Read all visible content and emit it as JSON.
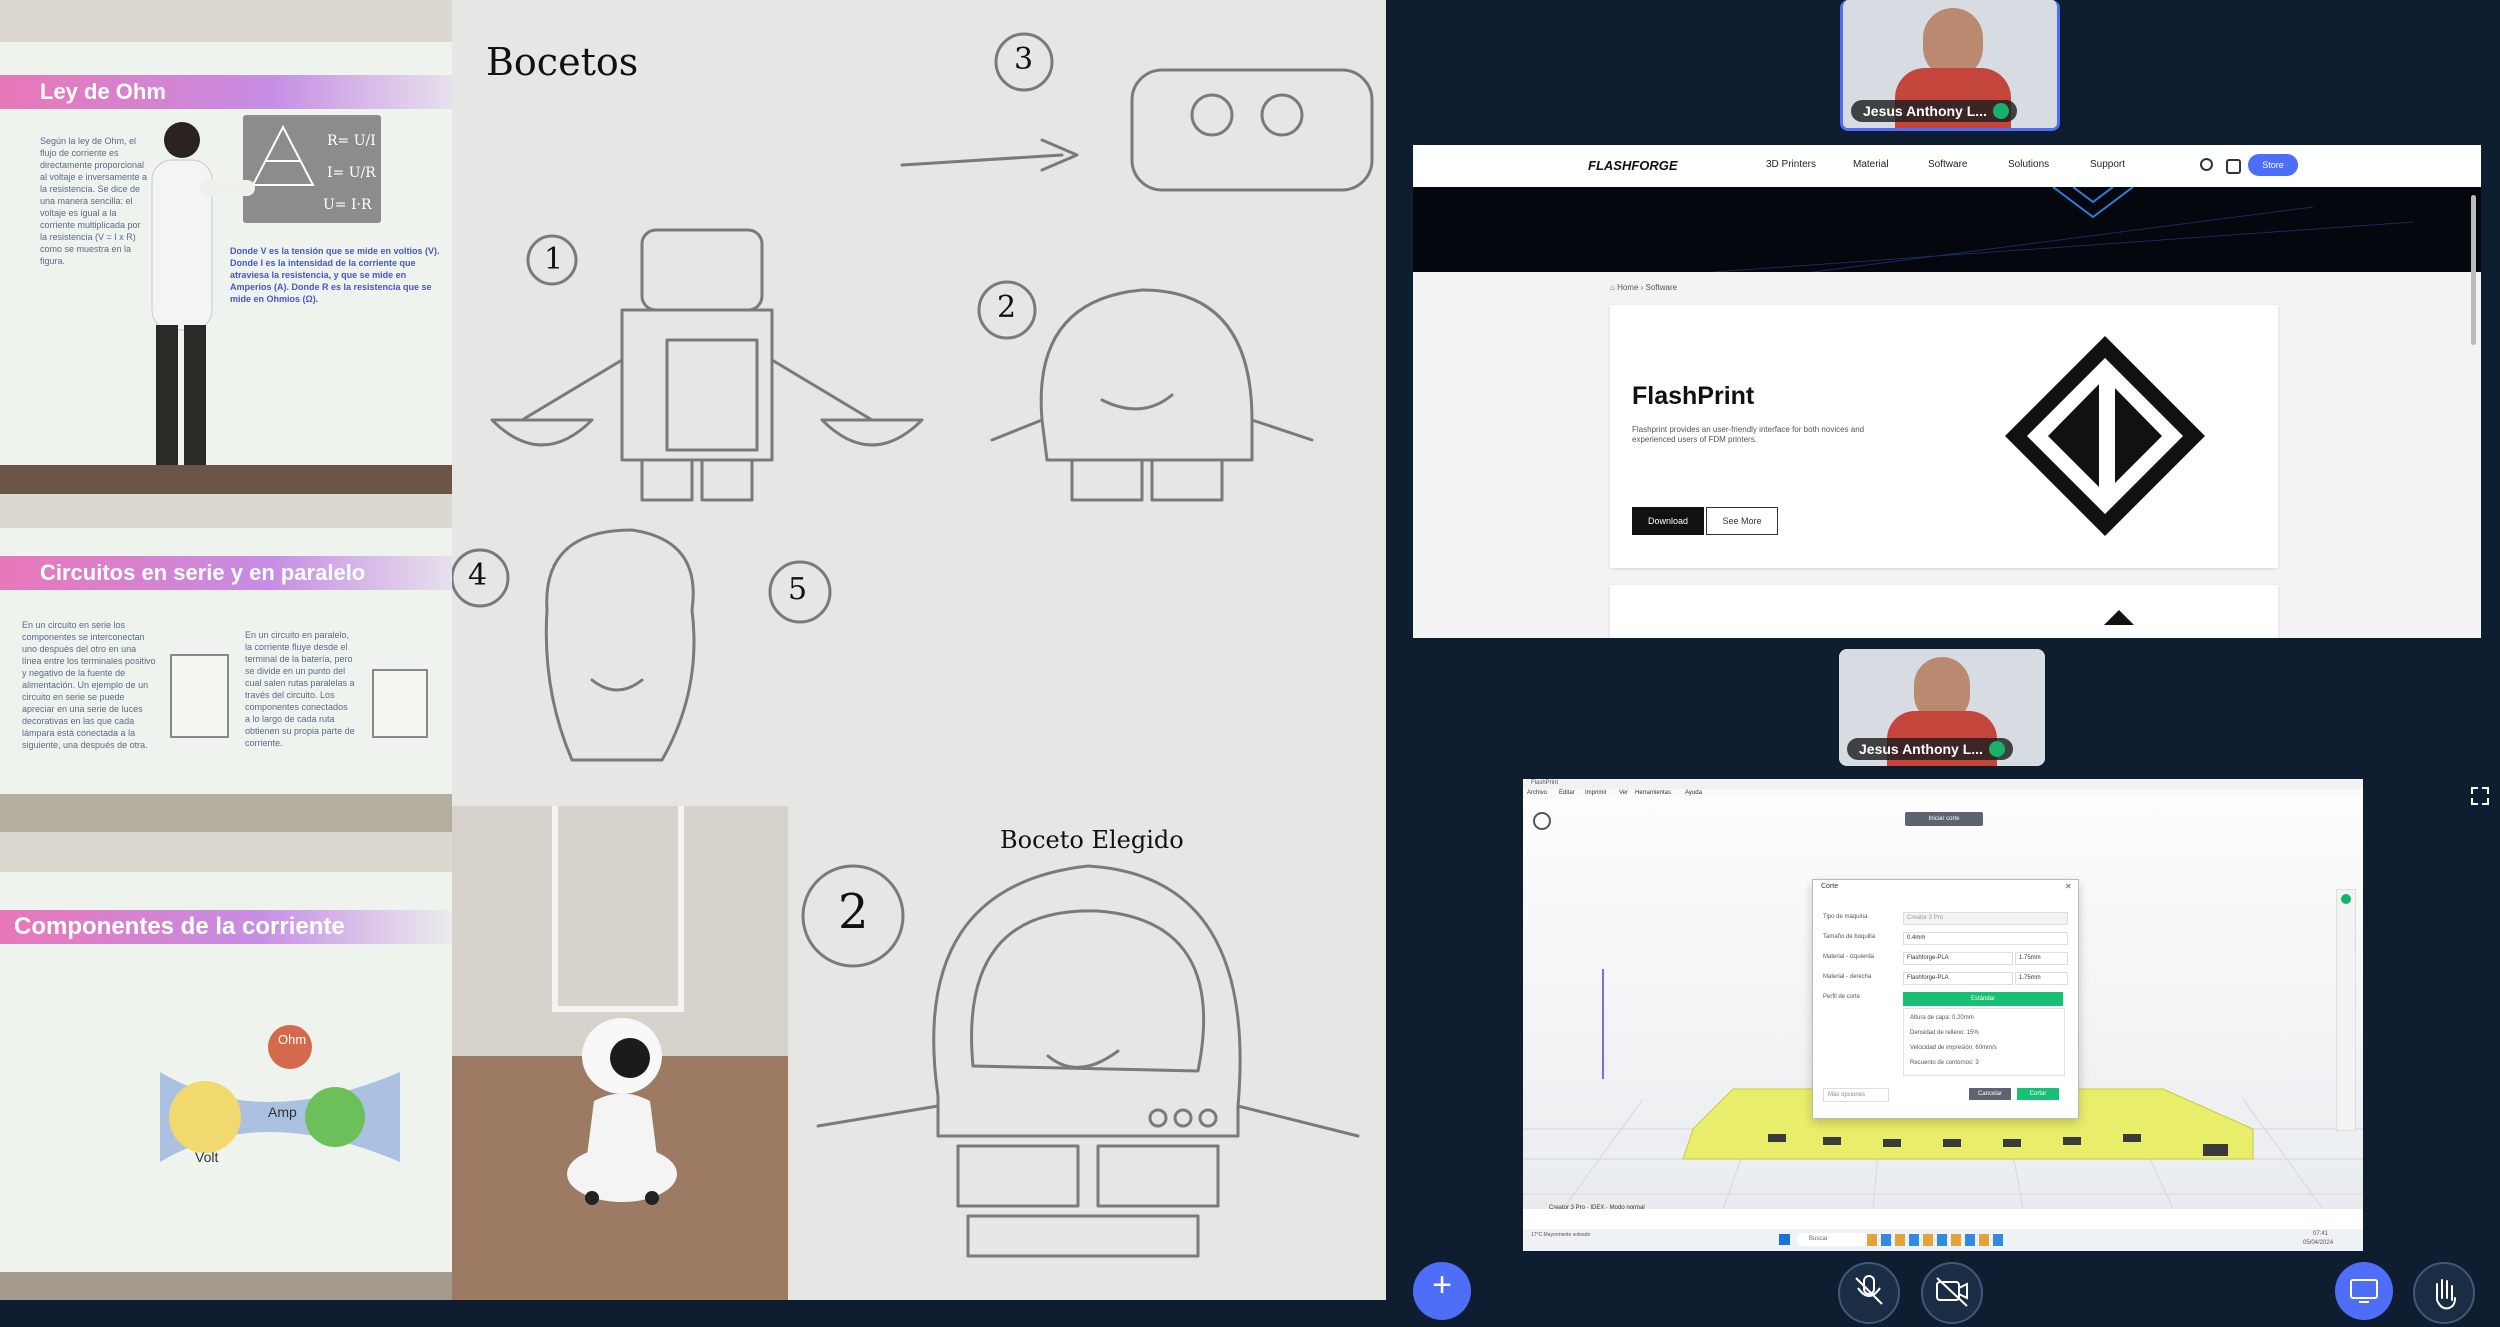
{
  "slides": {
    "ohm_title": "Ley de Ohm",
    "ohm_text_1": "Según la ley de Ohm, el flujo de corriente es directamente proporcional al voltaje e inversamente a la resistencia. Se dice de una manera sencilla: el voltaje es igual a la corriente multiplicada por la resistencia (V = I x R) como se muestra en la figura.",
    "ohm_text_2": "Donde V es la tensión que se mide en voltios (V). Donde I es la intensidad de la corriente que atraviesa la resistencia, y que se mide en Amperios (A). Donde R es la resistencia que se mide en Ohmios (Ω).",
    "circuits_title": "Circuitos en serie y en paralelo",
    "circuits_text_left": "En un circuito en serie los componentes se interconectan uno después del otro en una línea entre los terminales positivo y negativo de la fuente de alimentación. Un ejemplo de un circuito en serie se puede apreciar en una serie de luces decorativas en las que cada lámpara está conectada a la siguiente, una después de otra.",
    "circuits_text_right": "En un circuito en paralelo, la corriente fluye desde el terminal de la batería, pero se divide en un punto del cual salen rutas paralelas a través del circuito. Los componentes conectados a lo largo de cada ruta obtienen su propia parte de corriente.",
    "components_title": "Componentes de la corriente",
    "components_labels": [
      "Volt",
      "Amp",
      "Ohm"
    ]
  },
  "sketches": {
    "title": "Bocetos",
    "chosen_title": "Boceto Elegido",
    "numbers": [
      "1",
      "2",
      "3",
      "4",
      "5"
    ],
    "chosen_number": "2"
  },
  "meeting": {
    "participant_name_1": "Jesus Anthony L...",
    "participant_name_2": "Jesus Anthony L...",
    "brand_color": "#4f6ef7",
    "controls": [
      "add-icon",
      "mic-muted-icon",
      "camera-off-icon",
      "share-screen-icon",
      "raise-hand-icon"
    ]
  },
  "flashforge": {
    "logo": "FLASHFORGE",
    "nav": [
      "3D Printers",
      "Material",
      "Software",
      "Solutions",
      "Support"
    ],
    "store": "Store",
    "breadcrumb_home": "Home",
    "breadcrumb_current": "Software",
    "product_title": "FlashPrint",
    "product_desc": "Flashprint provides an user-friendly interface for both novices and experienced users of FDM printers.",
    "download": "Download",
    "see_more": "See More"
  },
  "slicer": {
    "window_title": "FlashPrint",
    "menus": [
      "Archivo",
      "Editar",
      "Imprimir",
      "Ver",
      "Herramientas",
      "Ayuda"
    ],
    "start_slicing": "Iniciar corte",
    "dialog_title": "Corte",
    "fields": [
      {
        "label": "Tipo de máquina",
        "value": "Creator 3 Pro"
      },
      {
        "label": "Tamaño de boquilla",
        "value": "0.4mm"
      },
      {
        "label": "Material - izquierda",
        "value": "Flashforge-PLA"
      },
      {
        "label": "Material - derecha",
        "value": "Flashforge-PLA"
      }
    ],
    "diameter_1": "1.75mm",
    "diameter_2": "1.75mm",
    "profile_label": "Perfil de corte",
    "profile_value": "Estándar",
    "details": [
      "Altura de capa: 0.20mm",
      "Densidad de relleno: 15%",
      "Velocidad de impresión: 60mm/s",
      "Recuento de contornos: 3"
    ],
    "more_options": "Más opciones",
    "cancel": "Cancelar",
    "slice": "Cortar",
    "status": "Creator 3 Pro  ·  IDEX  ·  Modo normal",
    "taskbar_search": "Buscar",
    "taskbar_weather": "17°C  Mayormente soleado",
    "taskbar_time": "07:41",
    "taskbar_date": "05/04/2024"
  }
}
